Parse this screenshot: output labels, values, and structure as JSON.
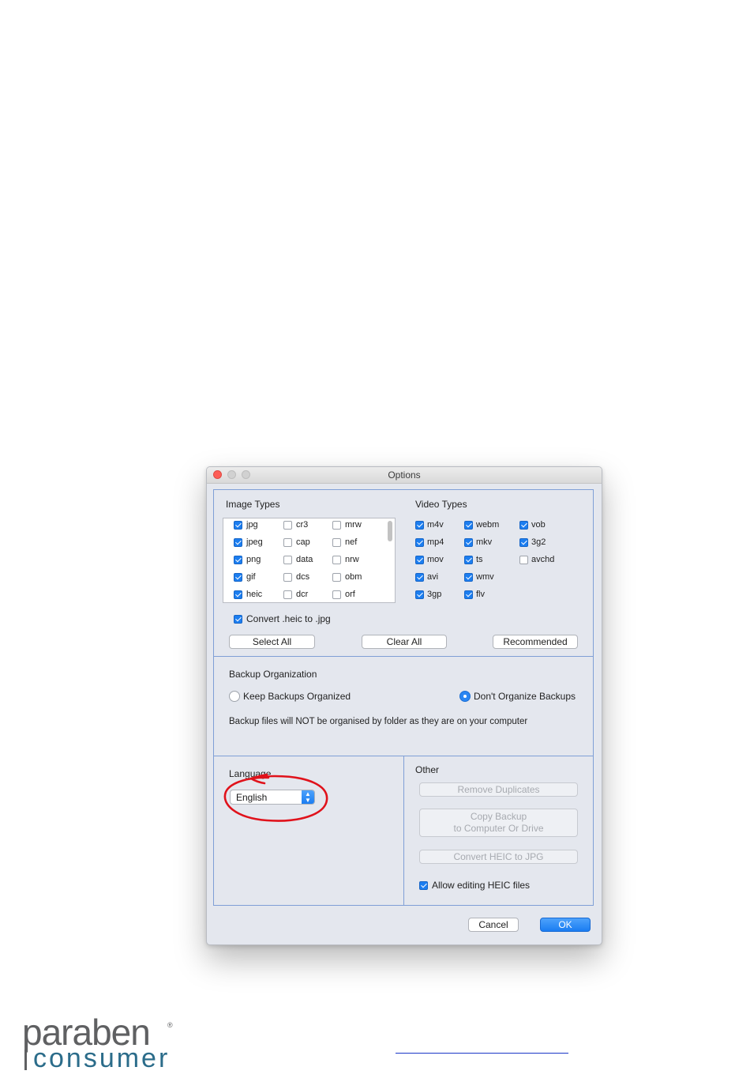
{
  "window": {
    "title": "Options"
  },
  "image_types": {
    "title": "Image Types",
    "items": [
      {
        "label": "jpg",
        "checked": true
      },
      {
        "label": "cr3",
        "checked": false
      },
      {
        "label": "mrw",
        "checked": false
      },
      {
        "label": "jpeg",
        "checked": true
      },
      {
        "label": "cap",
        "checked": false
      },
      {
        "label": "nef",
        "checked": false
      },
      {
        "label": "png",
        "checked": true
      },
      {
        "label": "data",
        "checked": false
      },
      {
        "label": "nrw",
        "checked": false
      },
      {
        "label": "gif",
        "checked": true
      },
      {
        "label": "dcs",
        "checked": false
      },
      {
        "label": "obm",
        "checked": false
      },
      {
        "label": "heic",
        "checked": true
      },
      {
        "label": "dcr",
        "checked": false
      },
      {
        "label": "orf",
        "checked": false
      }
    ],
    "convert": {
      "label": "Convert .heic to .jpg",
      "checked": true
    }
  },
  "video_types": {
    "title": "Video Types",
    "items": [
      {
        "label": "m4v",
        "checked": true
      },
      {
        "label": "webm",
        "checked": true
      },
      {
        "label": "vob",
        "checked": true
      },
      {
        "label": "mp4",
        "checked": true
      },
      {
        "label": "mkv",
        "checked": true
      },
      {
        "label": "3g2",
        "checked": true
      },
      {
        "label": "mov",
        "checked": true
      },
      {
        "label": "ts",
        "checked": true
      },
      {
        "label": "avchd",
        "checked": false
      },
      {
        "label": "avi",
        "checked": true
      },
      {
        "label": "wmv",
        "checked": true
      },
      {
        "label": "3gp",
        "checked": true
      },
      {
        "label": "flv",
        "checked": true
      }
    ]
  },
  "buttons": {
    "select_all": "Select All",
    "clear_all": "Clear All",
    "recommended": "Recommended"
  },
  "backup": {
    "title": "Backup Organization",
    "keep": "Keep Backups Organized",
    "dont": "Don't Organize Backups",
    "selected": "dont",
    "description": "Backup files will NOT be organised by folder as they are on your computer"
  },
  "language": {
    "title": "Language",
    "value": "English"
  },
  "other": {
    "title": "Other",
    "remove_duplicates": "Remove Duplicates",
    "copy_backup_line1": "Copy Backup",
    "copy_backup_line2": "to Computer Or Drive",
    "convert_heic": "Convert HEIC to JPG",
    "allow_editing": {
      "label": "Allow editing HEIC files",
      "checked": true
    }
  },
  "footer": {
    "cancel": "Cancel",
    "ok": "OK"
  },
  "logo": {
    "top": "paraben",
    "bottom": "consumer",
    "reg": "®"
  },
  "colors": {
    "accent": "#1c7ef0",
    "annotation": "#e0121b",
    "panel_border": "#7f9fd6"
  }
}
